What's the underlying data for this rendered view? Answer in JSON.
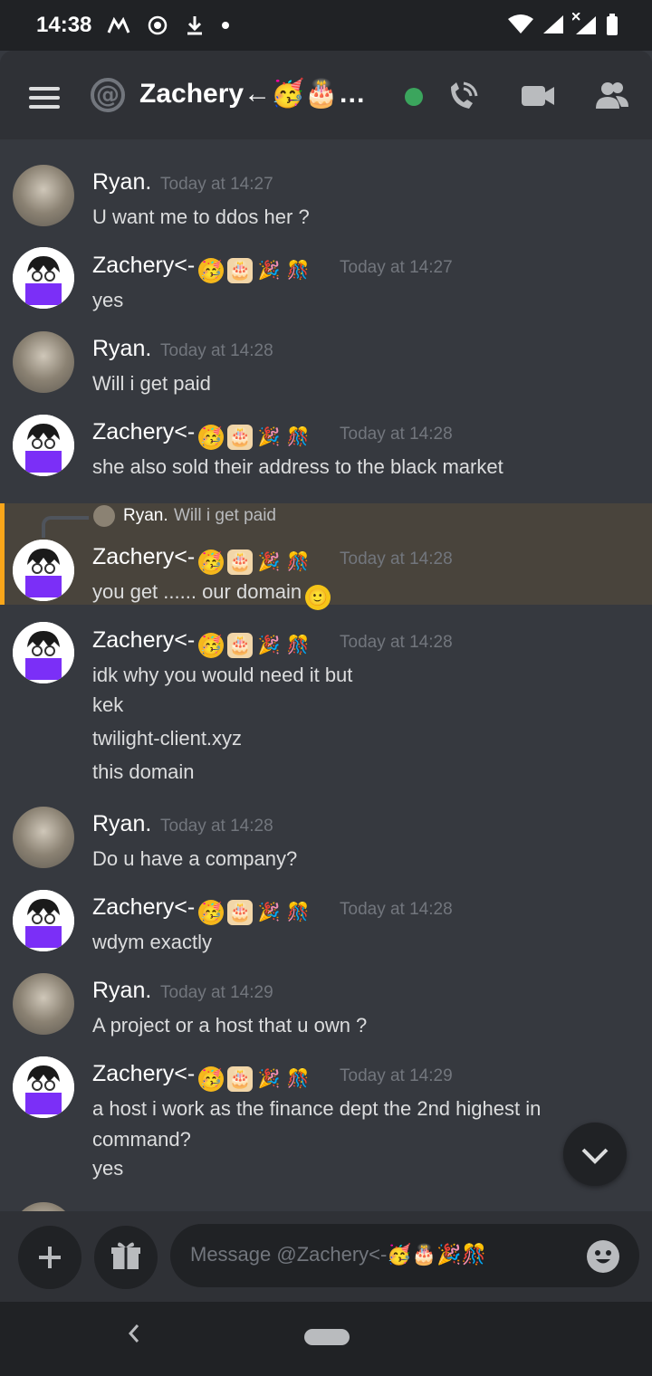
{
  "status_bar": {
    "time": "14:38"
  },
  "header": {
    "title": "Zachery←🥳🎂…",
    "channel_symbol": "@"
  },
  "messages": [
    {
      "author": "Ryan.",
      "time": "Today at 14:27",
      "lines": [
        "U want me to ddos her ?"
      ]
    },
    {
      "author": "Zachery<-",
      "time": "Today at 14:27",
      "lines": [
        "yes"
      ]
    },
    {
      "author": "Ryan.",
      "time": "Today at 14:28",
      "lines": [
        "Will i get paid"
      ]
    },
    {
      "author": "Zachery<-",
      "time": "Today at 14:28",
      "lines": [
        "she also sold their address to the black market"
      ]
    },
    {
      "author": "Zachery<-",
      "time": "Today at 14:28",
      "lines": [
        "you get ...... our domain"
      ],
      "reply_to": {
        "author": "Ryan.",
        "text": "Will i get paid"
      }
    },
    {
      "author": "Zachery<-",
      "time": "Today at 14:28",
      "lines": [
        "idk why you would need it but",
        "kek",
        "twilight-client.xyz",
        "this domain"
      ]
    },
    {
      "author": "Ryan.",
      "time": "Today at 14:28",
      "lines": [
        "Do u have a company?"
      ]
    },
    {
      "author": "Zachery<-",
      "time": "Today at 14:28",
      "lines": [
        "wdym exactly"
      ]
    },
    {
      "author": "Ryan.",
      "time": "Today at 14:29",
      "lines": [
        "A project or a host that u own ?"
      ]
    },
    {
      "author": "Zachery<-",
      "time": "Today at 14:29",
      "lines": [
        "a host i work as the finance dept the 2nd highest in",
        "command?",
        "yes"
      ]
    }
  ],
  "composer": {
    "placeholder": "Message @Zachery<-🥳🎂🎉🎊"
  },
  "emojis": {
    "e1": "🥳",
    "e2": "🎂",
    "e3": "🎉",
    "e4": "🎊",
    "smile": "🙂"
  },
  "colors": {
    "accent": "#faa61a",
    "online": "#3ba55d",
    "background": "#36393f"
  }
}
